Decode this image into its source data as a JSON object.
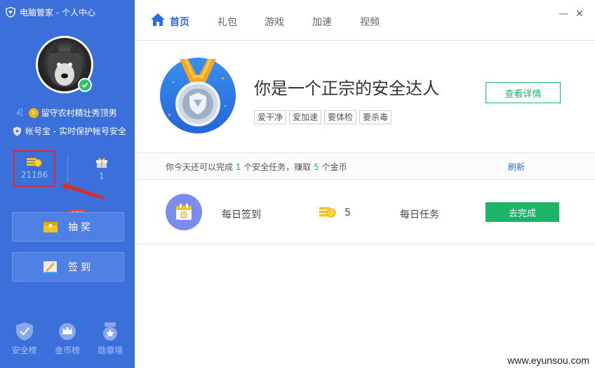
{
  "window": {
    "title": "电脑管家 - 个人中心",
    "minimize_glyph": "—",
    "close_glyph": "✕"
  },
  "user": {
    "zodiac_glyph": "♌",
    "level_badge": "$",
    "nickname": "留守农村精壮秀顶男",
    "account_line": "帐号宝 - 实时保护帐号安全"
  },
  "stats": {
    "coins": "21186",
    "gifts": "1"
  },
  "sidebar": {
    "new_tag": "new",
    "lottery_label": "抽奖",
    "checkin_label": "签到",
    "bottom_nav": [
      {
        "label": "安全榜",
        "icon": "shield-check-icon"
      },
      {
        "label": "金币榜",
        "icon": "crown-icon"
      },
      {
        "label": "勋章墙",
        "icon": "medal-icon"
      }
    ]
  },
  "topnav": {
    "tabs": [
      {
        "label": "首页",
        "active": true
      },
      {
        "label": "礼包"
      },
      {
        "label": "游戏"
      },
      {
        "label": "加速"
      },
      {
        "label": "视频"
      }
    ]
  },
  "hero": {
    "title": "你是一个正宗的安全达人",
    "tags": [
      "爱干净",
      "爱加速",
      "要体检",
      "要杀毒"
    ],
    "detail_button": "查看详情"
  },
  "tasks": {
    "summary_prefix": "你今天还可以完成 ",
    "task_count": "1",
    "summary_middle": " 个安全任务，赚取 ",
    "coin_count": "5",
    "summary_suffix": " 个金币",
    "refresh_label": "刷新",
    "items": [
      {
        "name": "每日签到",
        "reward": "5",
        "type": "每日任务",
        "action": "去完成"
      }
    ]
  },
  "watermark": "www.eyunsou.com",
  "colors": {
    "sidebar_bg": "#3b6fd9",
    "accent_blue": "#2b6fe0",
    "accent_green": "#1db46a",
    "highlight_red": "#e02a2a"
  }
}
